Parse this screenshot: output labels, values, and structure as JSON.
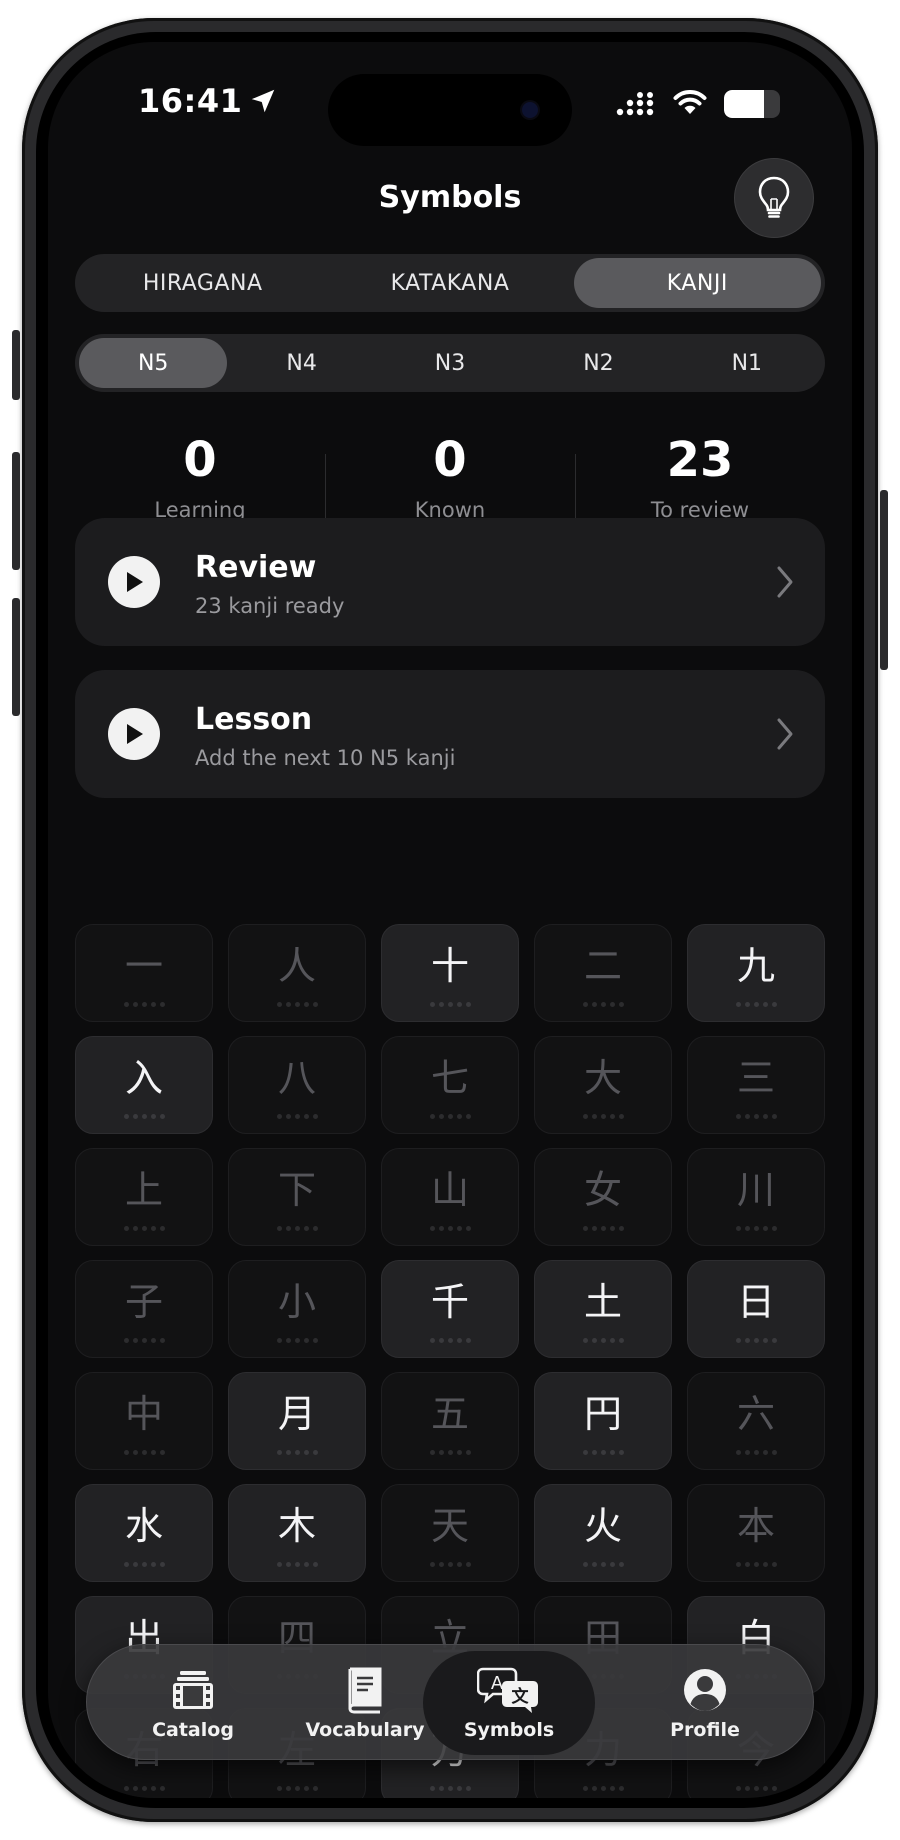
{
  "status_bar": {
    "time": "16:41",
    "battery_level": 0.72
  },
  "header": {
    "title": "Symbols",
    "hint_icon": "lightbulb-icon"
  },
  "script_tabs": [
    {
      "label": "HIRAGANA",
      "active": false
    },
    {
      "label": "KATAKANA",
      "active": false
    },
    {
      "label": "KANJI",
      "active": true
    }
  ],
  "level_tabs": [
    {
      "label": "N5",
      "active": true
    },
    {
      "label": "N4",
      "active": false
    },
    {
      "label": "N3",
      "active": false
    },
    {
      "label": "N2",
      "active": false
    },
    {
      "label": "N1",
      "active": false
    }
  ],
  "stats": [
    {
      "value": "0",
      "label": "Learning"
    },
    {
      "value": "0",
      "label": "Known"
    },
    {
      "value": "23",
      "label": "To review"
    }
  ],
  "review_card": {
    "title": "Review",
    "subtitle": "23 kanji ready"
  },
  "lesson_card": {
    "title": "Lesson",
    "subtitle": "Add the next 10 N5 kanji"
  },
  "kanji": [
    {
      "char": "一",
      "lit": false
    },
    {
      "char": "人",
      "lit": false
    },
    {
      "char": "十",
      "lit": true
    },
    {
      "char": "二",
      "lit": false
    },
    {
      "char": "九",
      "lit": true
    },
    {
      "char": "入",
      "lit": true
    },
    {
      "char": "八",
      "lit": false
    },
    {
      "char": "七",
      "lit": false
    },
    {
      "char": "大",
      "lit": false
    },
    {
      "char": "三",
      "lit": false
    },
    {
      "char": "上",
      "lit": false
    },
    {
      "char": "下",
      "lit": false
    },
    {
      "char": "山",
      "lit": false
    },
    {
      "char": "女",
      "lit": false
    },
    {
      "char": "川",
      "lit": false
    },
    {
      "char": "子",
      "lit": false
    },
    {
      "char": "小",
      "lit": false
    },
    {
      "char": "千",
      "lit": true
    },
    {
      "char": "土",
      "lit": true
    },
    {
      "char": "日",
      "lit": true
    },
    {
      "char": "中",
      "lit": false
    },
    {
      "char": "月",
      "lit": true
    },
    {
      "char": "五",
      "lit": false
    },
    {
      "char": "円",
      "lit": true
    },
    {
      "char": "六",
      "lit": false
    },
    {
      "char": "水",
      "lit": true
    },
    {
      "char": "木",
      "lit": true
    },
    {
      "char": "天",
      "lit": false
    },
    {
      "char": "火",
      "lit": true
    },
    {
      "char": "本",
      "lit": false
    },
    {
      "char": "出",
      "lit": true
    },
    {
      "char": "四",
      "lit": false
    },
    {
      "char": "立",
      "lit": false
    },
    {
      "char": "田",
      "lit": false
    },
    {
      "char": "白",
      "lit": true
    },
    {
      "char": "右",
      "lit": false
    },
    {
      "char": "左",
      "lit": false
    },
    {
      "char": "万",
      "lit": true
    },
    {
      "char": "力",
      "lit": false
    },
    {
      "char": "今",
      "lit": false
    }
  ],
  "tab_bar": [
    {
      "label": "Catalog",
      "icon": "film-stack-icon",
      "active": false
    },
    {
      "label": "Vocabulary",
      "icon": "book-icon",
      "active": false
    },
    {
      "label": "Symbols",
      "icon": "translate-icon",
      "active": true
    },
    {
      "label": "Profile",
      "icon": "person-circle-icon",
      "active": false
    }
  ]
}
